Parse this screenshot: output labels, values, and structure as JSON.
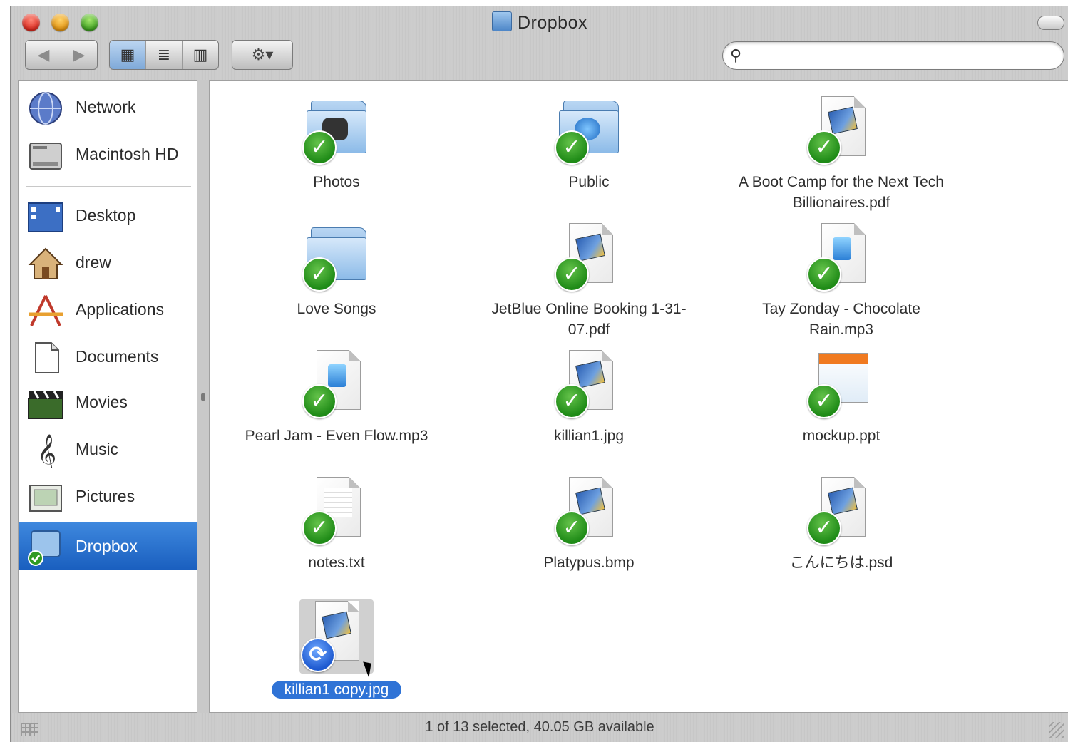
{
  "window": {
    "title": "Dropbox"
  },
  "toolbar": {
    "back_icon": "back-arrow-icon",
    "forward_icon": "forward-arrow-icon",
    "views": [
      "icon-view-icon",
      "list-view-icon",
      "column-view-icon"
    ],
    "active_view": "icon",
    "action_icon": "gear-icon",
    "search": {
      "value": "",
      "placeholder": ""
    }
  },
  "sidebar": {
    "devices": [
      {
        "label": "Network",
        "icon": "network-globe-icon"
      },
      {
        "label": "Macintosh HD",
        "icon": "hard-drive-icon"
      }
    ],
    "places": [
      {
        "label": "Desktop",
        "icon": "desktop-icon"
      },
      {
        "label": "drew",
        "icon": "home-icon"
      },
      {
        "label": "Applications",
        "icon": "applications-icon"
      },
      {
        "label": "Documents",
        "icon": "documents-icon"
      },
      {
        "label": "Movies",
        "icon": "movies-clapper-icon"
      },
      {
        "label": "Music",
        "icon": "music-treble-clef-icon"
      },
      {
        "label": "Pictures",
        "icon": "pictures-icon"
      },
      {
        "label": "Dropbox",
        "icon": "dropbox-folder-icon",
        "selected": true
      }
    ]
  },
  "files": [
    {
      "name": "Photos",
      "kind": "folder",
      "status": "synced"
    },
    {
      "name": "Public",
      "kind": "folder",
      "status": "synced"
    },
    {
      "name": "A Boot Camp for the Next Tech Billionaires.pdf",
      "kind": "pdf",
      "status": "synced"
    },
    {
      "name": "Love Songs",
      "kind": "folder",
      "status": "synced"
    },
    {
      "name": "JetBlue Online Booking 1-31-07.pdf",
      "kind": "pdf",
      "status": "synced"
    },
    {
      "name": "Tay Zonday - Chocolate Rain.mp3",
      "kind": "mp3",
      "status": "synced"
    },
    {
      "name": "Pearl Jam - Even Flow.mp3",
      "kind": "mp3",
      "status": "synced"
    },
    {
      "name": "killian1.jpg",
      "kind": "jpg",
      "status": "synced"
    },
    {
      "name": "mockup.ppt",
      "kind": "ppt",
      "status": "synced"
    },
    {
      "name": "notes.txt",
      "kind": "txt",
      "status": "synced"
    },
    {
      "name": "Platypus.bmp",
      "kind": "bmp",
      "status": "synced"
    },
    {
      "name": "こんにちは.psd",
      "kind": "psd",
      "status": "synced"
    },
    {
      "name": "killian1 copy.jpg",
      "kind": "jpg",
      "status": "syncing",
      "selected": true
    }
  ],
  "status": {
    "text": "1 of 13 selected, 40.05 GB available"
  },
  "colors": {
    "selection": "#2f73d6",
    "sync_ok": "#1f8b17",
    "syncing": "#1e5ad0"
  }
}
